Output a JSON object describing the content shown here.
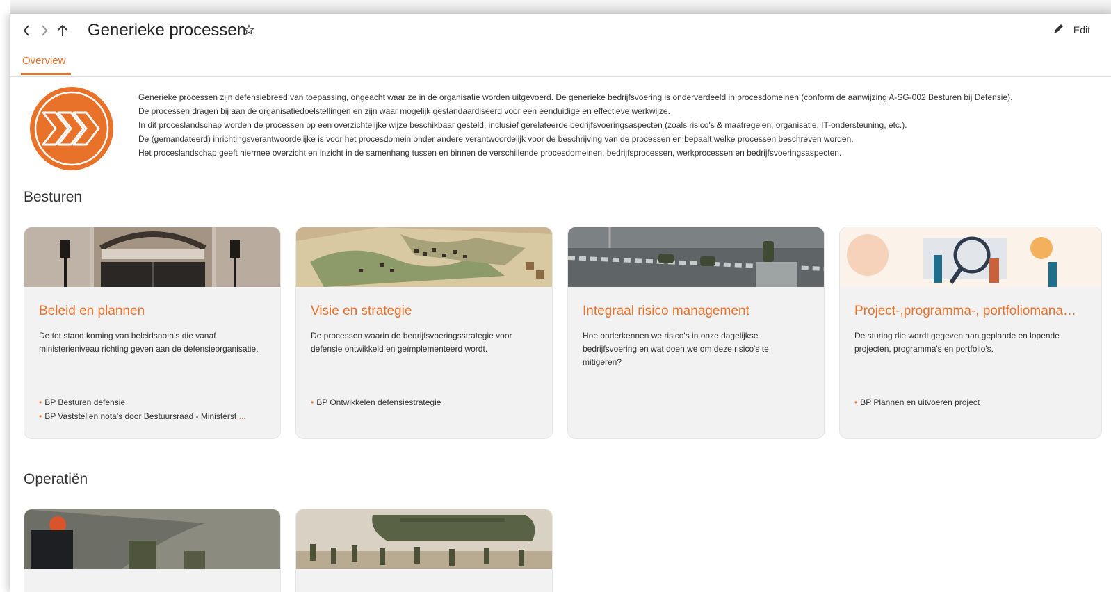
{
  "header": {
    "title": "Generieke processen",
    "edit_label": "Edit"
  },
  "tabs": [
    {
      "label": "Overview",
      "active": true
    }
  ],
  "intro": {
    "paragraphs": [
      "Generieke processen zijn defensiebreed van toepassing, ongeacht waar ze in de organisatie worden uitgevoerd. De generieke bedrijfsvoering is onderverdeeld in procesdomeinen (conform de aanwijzing A-SG-002 Besturen bij Defensie).",
      "De processen dragen bij aan de organisatiedoelstellingen en zijn waar mogelijk gestandaardiseerd voor een eenduidige en effectieve werkwijze.",
      "In dit proceslandschap worden de processen op een overzichtelijke wijze beschikbaar gesteld, inclusief gerelateerde bedrijfsvoeringsaspecten (zoals risico's & maatregelen, organisatie, IT-ondersteuning, etc.).",
      "De (gemandateerd) inrichtingsverantwoordelijke is voor het procesdomein onder andere verantwoordelijk voor de beschrijving van de processen en bepaalt welke processen beschreven worden.",
      "Het proceslandschap geeft hiermee overzicht en inzicht in de samenhang tussen en binnen de verschillende procesdomeinen, bedrijfsprocessen, werkprocessen en bedrijfsvoeringsaspecten."
    ]
  },
  "sections": [
    {
      "title": "Besturen",
      "cards": [
        {
          "title": "Beleid en plannen",
          "description": "De tot stand koming van beleidsnota's die vanaf ministerieniveau richting geven aan de defensieorganisatie.",
          "links": [
            "BP Besturen defensie",
            "BP Vaststellen nota's door Bestuursraad - Ministerst"
          ],
          "more": "..."
        },
        {
          "title": "Visie en strategie",
          "description": "De processen waarin de bedrijfsvoeringsstrategie voor defensie ontwikkeld en geïmplementeerd wordt.",
          "links": [
            "BP Ontwikkelen defensiestrategie"
          ]
        },
        {
          "title": "Integraal risico management",
          "description": "Hoe onderkennen we risico's in onze dagelijkse bedrijfsvoering en wat doen we om deze risico's te mitigeren?",
          "links": []
        },
        {
          "title": "Project-,programma-, portfoliomanagement",
          "description": "De sturing die wordt gegeven aan geplande en lopende projecten, programma's en portfolio's.",
          "links": [
            "BP Plannen en uitvoeren project"
          ]
        }
      ]
    },
    {
      "title": "Operatiën",
      "cards": []
    }
  ],
  "colors": {
    "accent": "#e9722b",
    "card_bg": "#f2f2f2",
    "text": "#333333"
  }
}
